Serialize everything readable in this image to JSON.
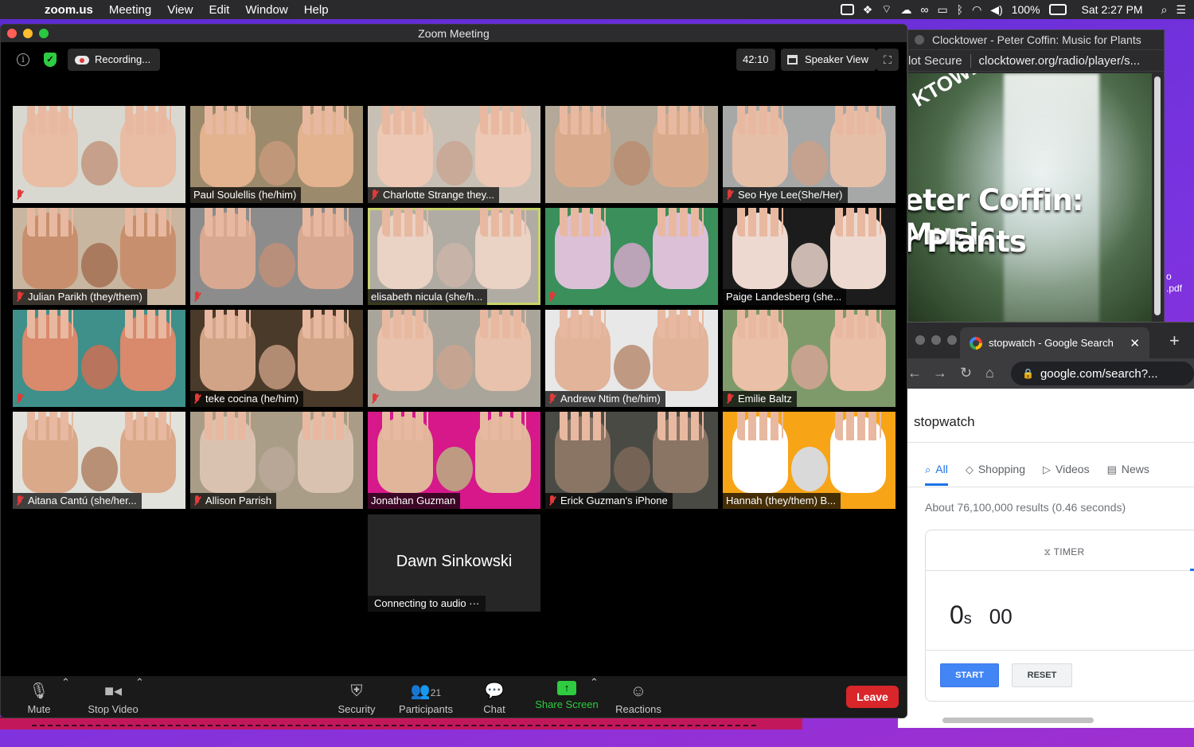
{
  "menubar": {
    "app": "zoom.us",
    "items": [
      "Meeting",
      "View",
      "Edit",
      "Window",
      "Help"
    ],
    "battery": "100%",
    "clock": "Sat 2:27 PM"
  },
  "zoom": {
    "window_title": "Zoom Meeting",
    "recording": "Recording...",
    "elapsed": "42:10",
    "view_mode": "Speaker View",
    "participants": [
      {
        "name": "",
        "muted": true,
        "skin": "#e9bca4",
        "bg": "#d8d8d0"
      },
      {
        "name": "Paul Soulellis (he/him)",
        "muted": false,
        "skin": "#e3b28f",
        "bg": "#9c8a6c"
      },
      {
        "name": "Charlotte Strange they...",
        "muted": true,
        "skin": "#edc8b4",
        "bg": "#c8c0b4"
      },
      {
        "name": "",
        "muted": false,
        "skin": "#d9ab8c",
        "bg": "#b4a898"
      },
      {
        "name": "Seo Hye Lee(She/Her)",
        "muted": true,
        "skin": "#e6bfa8",
        "bg": "#a6a8a8"
      },
      {
        "name": "Julian Parikh (they/them)",
        "muted": true,
        "skin": "#c88f6e",
        "bg": "#c9b6a0"
      },
      {
        "name": "",
        "muted": true,
        "skin": "#d9a891",
        "bg": "#8c8c8c"
      },
      {
        "name": "elisabeth nicula (she/h...",
        "muted": false,
        "skin": "#ead2c4",
        "bg": "#b0aca4",
        "active": true
      },
      {
        "name": "",
        "muted": true,
        "skin": "#dcc0d8",
        "bg": "#3a8f5a"
      },
      {
        "name": "Paige Landesberg (she...",
        "muted": false,
        "skin": "#eed9d0",
        "bg": "#1c1c1c"
      },
      {
        "name": "",
        "muted": true,
        "skin": "#d9896c",
        "bg": "#3f8f8a"
      },
      {
        "name": "teke cocina (he/him)",
        "muted": true,
        "skin": "#d1a487",
        "bg": "#4a3a2a"
      },
      {
        "name": "",
        "muted": true,
        "skin": "#e8c2ac",
        "bg": "#aaa59a"
      },
      {
        "name": "Andrew Ntim (he/him)",
        "muted": true,
        "skin": "#e2b49a",
        "bg": "#e8e8e8"
      },
      {
        "name": "Emilie Baltz",
        "muted": true,
        "skin": "#eac0a8",
        "bg": "#7f9a6a"
      },
      {
        "name": "Aitana Cantú (she/her...",
        "muted": true,
        "skin": "#d9a98a",
        "bg": "#e2e2dc"
      },
      {
        "name": "Allison Parrish",
        "muted": true,
        "skin": "#d9c3b0",
        "bg": "#a99d88"
      },
      {
        "name": "Jonathan Guzman",
        "muted": false,
        "skin": "#e0b59a",
        "bg": "#d6188a"
      },
      {
        "name": "Erick Guzman's iPhone",
        "muted": true,
        "skin": "#8a7565",
        "bg": "#4a4a44"
      },
      {
        "name": "Hannah (they/them) B...",
        "muted": false,
        "skin": "#ffffff",
        "bg": "#f7a417"
      }
    ],
    "pending": {
      "name": "Dawn Sinkowski",
      "status": "Connecting to audio ···"
    },
    "toolbar": {
      "mute": "Mute",
      "video": "Stop Video",
      "security": "Security",
      "participants": "Participants",
      "participant_count": "21",
      "chat": "Chat",
      "share": "Share Screen",
      "reactions": "Reactions",
      "leave": "Leave"
    }
  },
  "clocktower": {
    "tab_title": "Clocktower - Peter Coffin: Music for Plants",
    "security": "lot Secure",
    "url": "clocktower.org/radio/player/s...",
    "art_tower": "KTOWER",
    "art_line1": "eter Coffin: Music",
    "art_line2": "r Plants"
  },
  "desktop": {
    "file_label": "o\n.pdf"
  },
  "google": {
    "tab_title": "stopwatch - Google Search",
    "url": "google.com/search?...",
    "query": "stopwatch",
    "tabs": [
      "All",
      "Shopping",
      "Videos",
      "News"
    ],
    "results": "About 76,100,000 results (0.46 seconds)",
    "timer_label": "TIMER",
    "time_seconds": "0",
    "time_unit": "s",
    "time_ms": "00",
    "start": "START",
    "reset": "RESET"
  }
}
